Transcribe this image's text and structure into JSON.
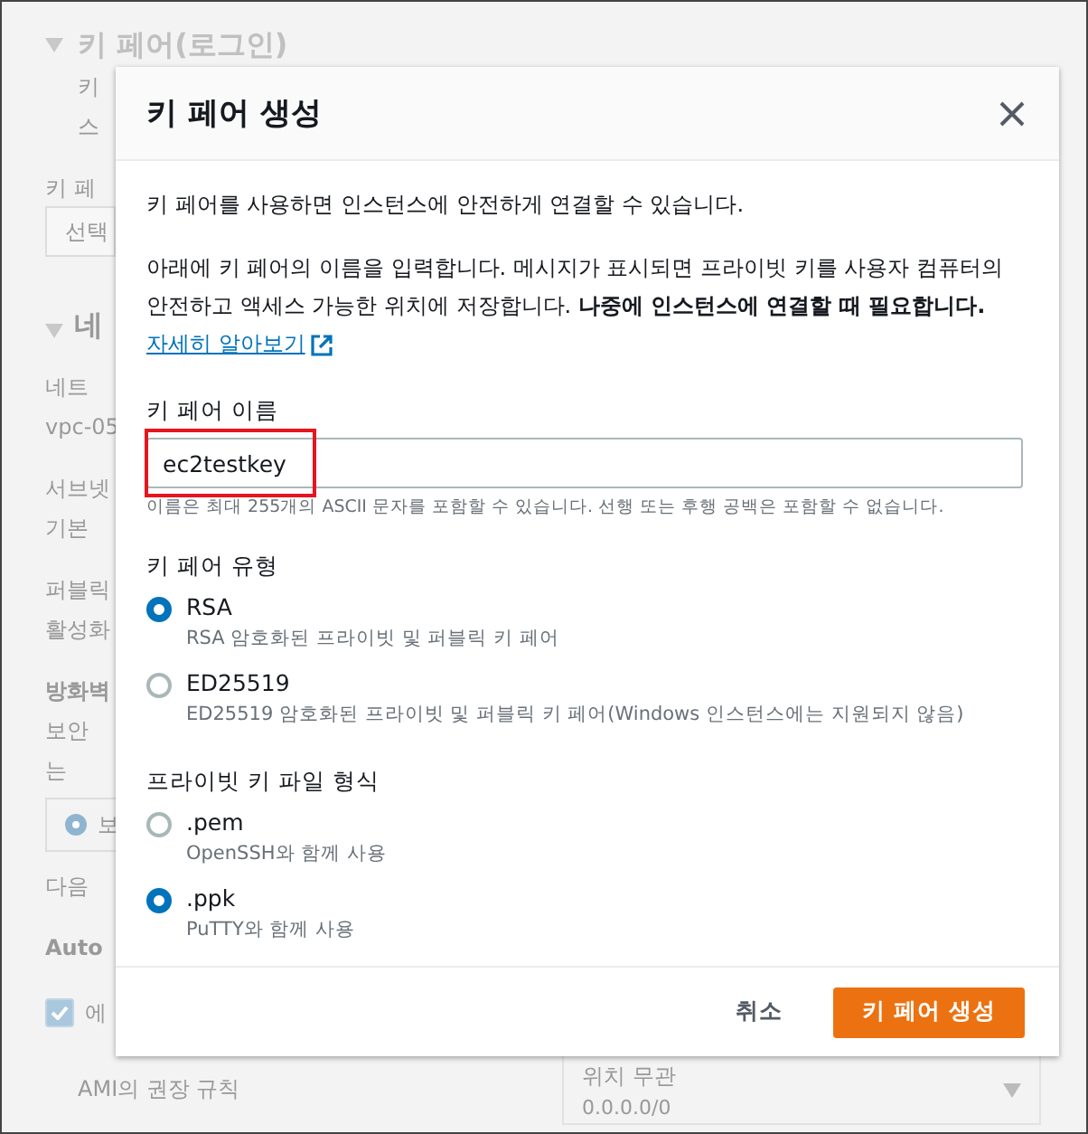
{
  "background": {
    "heading": "키 페어(로그인)",
    "left_column": [
      {
        "kind": "indent",
        "text": "키"
      },
      {
        "kind": "indent",
        "text": "스"
      },
      {
        "kind": "label",
        "text": "키 페"
      },
      {
        "kind": "select",
        "text": "선택"
      },
      {
        "kind": "section",
        "text": "네"
      },
      {
        "kind": "label",
        "text": "네트"
      },
      {
        "kind": "text",
        "text": "vpc-05"
      },
      {
        "kind": "label",
        "text": "서브넷"
      },
      {
        "kind": "text",
        "text": "기본"
      },
      {
        "kind": "label",
        "text": "퍼블릭"
      },
      {
        "kind": "text",
        "text": "활성화"
      },
      {
        "kind": "bold",
        "text": "방화벽"
      },
      {
        "kind": "note",
        "text": "보안"
      },
      {
        "kind": "note",
        "text": "는"
      },
      {
        "kind": "radio",
        "text": "보",
        "selected": true
      },
      {
        "kind": "label",
        "text": "다음"
      },
      {
        "kind": "bold",
        "text": "Auto"
      },
      {
        "kind": "checkbox",
        "text": "에",
        "checked": true
      }
    ],
    "bottom": {
      "note": "AMI의 권장 규칙",
      "select": {
        "value": "위치 무관",
        "detail": "0.0.0.0/0"
      }
    }
  },
  "dialog": {
    "title": "키 페어 생성",
    "intro": "키 페어를 사용하면 인스턴스에 안전하게 연결할 수 있습니다.",
    "description": "아래에 키 페어의 이름을 입력합니다. 메시지가 표시되면 프라이빗 키를 사용자 컴퓨터의 안전하고 액세스 가능한 위치에 저장합니다. **나중에 인스턴스에 연결할 때 필요합니다.**",
    "link": "자세히 알아보기",
    "name_field": {
      "label": "키 페어 이름",
      "value": "ec2testkey",
      "hint": "이름은 최대 255개의 ASCII 문자를 포함할 수 있습니다. 선행 또는 후행 공백은 포함할 수 없습니다."
    },
    "key_type": {
      "label": "키 페어 유형",
      "options": [
        {
          "label": "RSA",
          "description": "RSA 암호화된 프라이빗 및 퍼블릭 키 페어",
          "selected": true
        },
        {
          "label": "ED25519",
          "description": "ED25519 암호화된 프라이빗 및 퍼블릭 키 페어(Windows 인스턴스에는 지원되지 않음)",
          "selected": false
        }
      ]
    },
    "file_format": {
      "label": "프라이빗 키 파일 형식",
      "options": [
        {
          "label": ".pem",
          "description": "OpenSSH와 함께 사용",
          "selected": false
        },
        {
          "label": ".ppk",
          "description": "PuTTY와 함께 사용",
          "selected": true
        }
      ]
    },
    "buttons": {
      "cancel": "취소",
      "create": "키 페어 생성"
    }
  }
}
